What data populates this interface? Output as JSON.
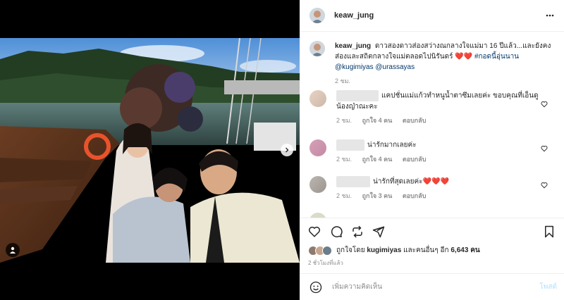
{
  "post": {
    "username": "keaw_jung",
    "more_icon": "more-horizontal-icon"
  },
  "caption": {
    "username": "keaw_jung",
    "text": "ดาวสองดาวส่องสว่างณกลางใจแม่มา 16 ปีแล้ว...และยังคงส่องและสถิตกลางใจแม่ตลอดไปนิรันดร์",
    "hearts": "❤️❤️",
    "hashtag": "#กอดนี้อุ่นนาน",
    "mention1": "@kugimiyas",
    "mention2": "@urassayas",
    "time": "2 ชม."
  },
  "comments": [
    {
      "text": "แคปชั่นแม่แก้วทำหนูน้ำตาซึมเลยค่ะ ขอบคุณที่เอ็นดูน้องญ๋าณะคะ",
      "time": "2 ชม.",
      "likes": "ถูกใจ 4 คน",
      "reply": "ตอบกลับ"
    },
    {
      "text": "น่ารักมากเลยค่ะ",
      "time": "2 ชม.",
      "likes": "ถูกใจ 4 คน",
      "reply": "ตอบกลับ"
    },
    {
      "text": "น่ารักที่สุดเลยค่ะ",
      "hearts": "❤️❤️❤️",
      "time": "2 ชม.",
      "likes": "ถูกใจ 3 คน",
      "reply": "ตอบกลับ"
    }
  ],
  "likes": {
    "prefix": "ถูกใจโดย",
    "user": "kugimiyas",
    "middle": "และคนอื่นๆ อีก",
    "count": "6,643",
    "suffix": "คน"
  },
  "timestamp": "2 ชั่วโมงที่แล้ว",
  "add_comment": {
    "placeholder": "เพิ่มความคิดเห็น",
    "post_label": "โพสต์"
  },
  "colors": {
    "link": "#00376b",
    "heart": "#ed4956",
    "post_disabled": "#b2dffc",
    "muted": "#8e8e8e"
  }
}
